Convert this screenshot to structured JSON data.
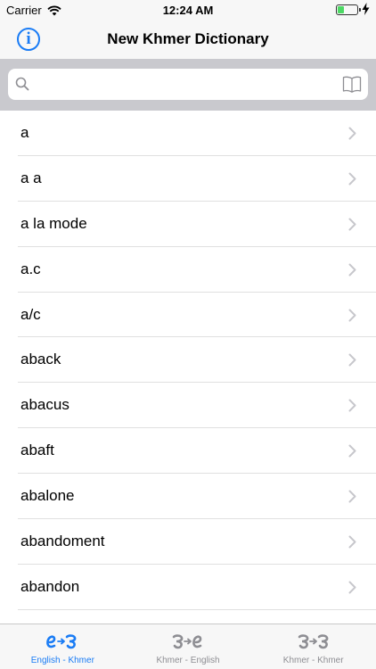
{
  "status_bar": {
    "carrier": "Carrier",
    "time": "12:24 AM",
    "battery_level": 0.35
  },
  "nav": {
    "title": "New Khmer Dictionary",
    "info_icon": "info-icon"
  },
  "search": {
    "placeholder": "",
    "value": ""
  },
  "words": [
    "a",
    "a a",
    "a la mode",
    "a.c",
    "a/c",
    "aback",
    "abacus",
    "abaft",
    "abalone",
    "abandoment",
    "abandon"
  ],
  "tabs": [
    {
      "label": "English - Khmer",
      "active": true
    },
    {
      "label": "Khmer - English",
      "active": false
    },
    {
      "label": "Khmer - Khmer",
      "active": false
    }
  ],
  "colors": {
    "accent": "#1a7cf5",
    "inactive": "#8e8e93",
    "search_bg": "#c9c9ce",
    "bar_bg": "#f7f7f7"
  }
}
